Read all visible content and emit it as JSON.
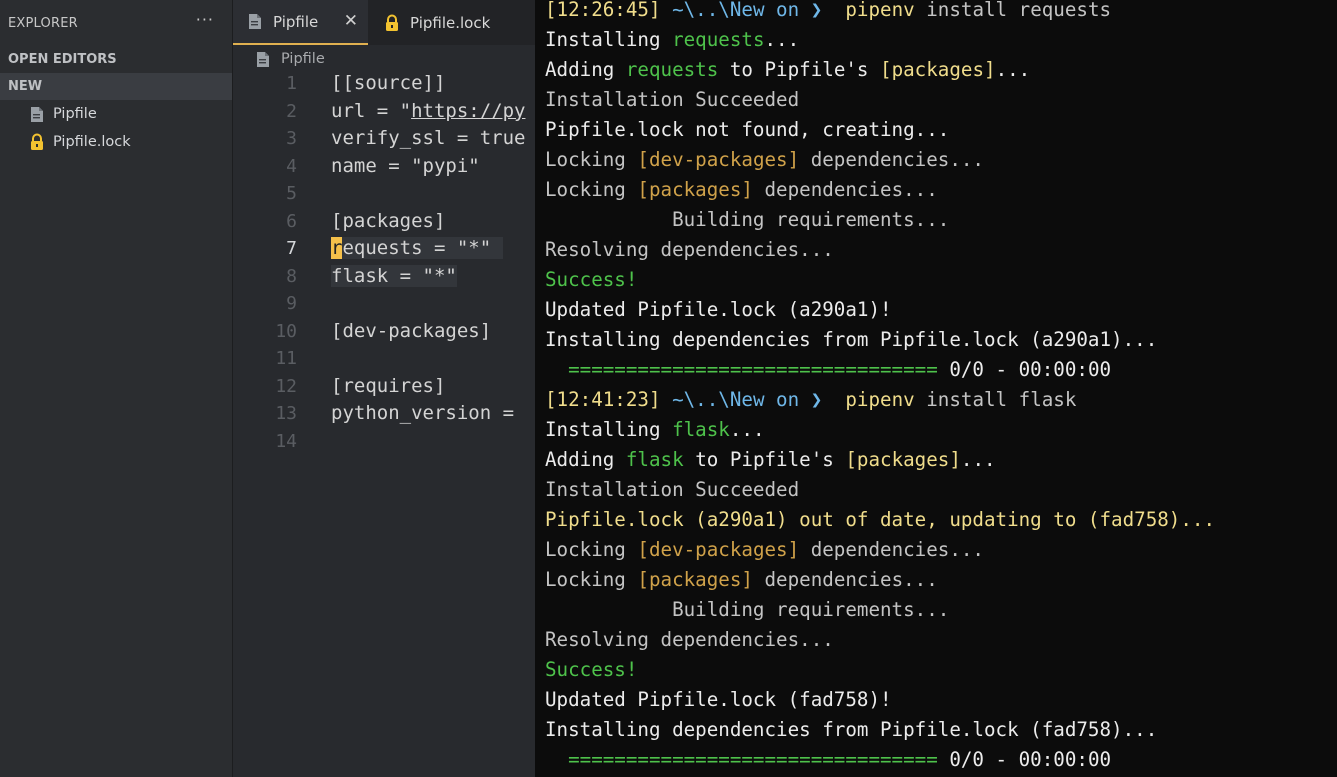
{
  "sidebar": {
    "title": "EXPLORER",
    "more": "···",
    "open_editors": "OPEN EDITORS",
    "folder": "NEW",
    "files": [
      {
        "name": "Pipfile",
        "icon": "file-icon"
      },
      {
        "name": "Pipfile.lock",
        "icon": "lock-icon"
      }
    ]
  },
  "editor": {
    "tabs": [
      {
        "label": "Pipfile",
        "close": "✕"
      },
      {
        "label": "Pipfile.lock"
      }
    ],
    "breadcrumb": "Pipfile",
    "current_line": 7,
    "lines": [
      {
        "n": "1",
        "text": "[[source]]"
      },
      {
        "n": "2",
        "pre": "url = \"",
        "url": "https://py"
      },
      {
        "n": "3",
        "text": "verify_ssl = true"
      },
      {
        "n": "4",
        "text": "name = \"pypi\""
      },
      {
        "n": "5",
        "text": ""
      },
      {
        "n": "6",
        "text": "[packages]"
      },
      {
        "n": "7",
        "cursor_char": "r",
        "text": "equests = \"*\""
      },
      {
        "n": "8",
        "text": "flask = \"*\""
      },
      {
        "n": "9",
        "text": ""
      },
      {
        "n": "10",
        "text": "[dev-packages]"
      },
      {
        "n": "11",
        "text": ""
      },
      {
        "n": "12",
        "text": "[requires]"
      },
      {
        "n": "13",
        "text": "python_version = "
      },
      {
        "n": "14",
        "text": ""
      }
    ]
  },
  "terminal": {
    "lines": [
      [
        [
          "[12:26:45] ",
          "yel"
        ],
        [
          "~\\..\\New on ❯ ",
          "blu"
        ],
        [
          " pipenv ",
          "yel"
        ],
        [
          "install requests",
          "gry"
        ]
      ],
      [
        [
          "Installing ",
          ""
        ],
        [
          "requests",
          "grn"
        ],
        [
          "...",
          ""
        ]
      ],
      [
        [
          "Adding ",
          ""
        ],
        [
          "requests",
          "grn"
        ],
        [
          " to Pipfile's ",
          ""
        ],
        [
          "[packages]",
          "yel"
        ],
        [
          "...",
          ""
        ]
      ],
      [
        [
          "Installation Succeeded",
          "gry"
        ]
      ],
      [
        [
          "Pipfile.lock not found, creating...",
          ""
        ]
      ],
      [
        [
          "Locking ",
          "gry"
        ],
        [
          "[dev-packages]",
          "gold"
        ],
        [
          " dependencies...",
          "gry"
        ]
      ],
      [
        [
          "Locking ",
          "gry"
        ],
        [
          "[packages]",
          "gold"
        ],
        [
          " dependencies...",
          "gry"
        ]
      ],
      [
        [
          "           Building requirements...",
          "gry"
        ]
      ],
      [
        [
          "Resolving dependencies...",
          "gry"
        ]
      ],
      [
        [
          "Success!",
          "grn"
        ]
      ],
      [
        [
          "Updated Pipfile.lock (a290a1)!",
          ""
        ]
      ],
      [
        [
          "Installing dependencies from Pipfile.lock (a290a1)...",
          ""
        ]
      ],
      [
        [
          "  ================================",
          "grn"
        ],
        [
          " 0/0 - 00:00:00",
          ""
        ]
      ],
      [
        [
          "[12:41:23] ",
          "yel"
        ],
        [
          "~\\..\\New on ❯ ",
          "blu"
        ],
        [
          " pipenv ",
          "yel"
        ],
        [
          "install flask",
          "gry"
        ]
      ],
      [
        [
          "Installing ",
          ""
        ],
        [
          "flask",
          "grn"
        ],
        [
          "...",
          ""
        ]
      ],
      [
        [
          "Adding ",
          ""
        ],
        [
          "flask",
          "grn"
        ],
        [
          " to Pipfile's ",
          ""
        ],
        [
          "[packages]",
          "yel"
        ],
        [
          "...",
          ""
        ]
      ],
      [
        [
          "Installation Succeeded",
          "gry"
        ]
      ],
      [
        [
          "Pipfile.lock (a290a1) out of date, updating to (fad758)...",
          "yel"
        ]
      ],
      [
        [
          "Locking ",
          "gry"
        ],
        [
          "[dev-packages]",
          "gold"
        ],
        [
          " dependencies...",
          "gry"
        ]
      ],
      [
        [
          "Locking ",
          "gry"
        ],
        [
          "[packages]",
          "gold"
        ],
        [
          " dependencies...",
          "gry"
        ]
      ],
      [
        [
          "           Building requirements...",
          "gry"
        ]
      ],
      [
        [
          "Resolving dependencies...",
          "gry"
        ]
      ],
      [
        [
          "Success!",
          "grn"
        ]
      ],
      [
        [
          "Updated Pipfile.lock (fad758)!",
          ""
        ]
      ],
      [
        [
          "Installing dependencies from Pipfile.lock (fad758)...",
          ""
        ]
      ],
      [
        [
          "  ================================",
          "grn"
        ],
        [
          " 0/0 - 00:00:00",
          ""
        ]
      ]
    ]
  },
  "colors": {
    "sidebar_bg": "#2b2d30",
    "editor_bg": "#282a2e",
    "terminal_bg": "#0c0c0c",
    "accent": "#f5c04a"
  }
}
